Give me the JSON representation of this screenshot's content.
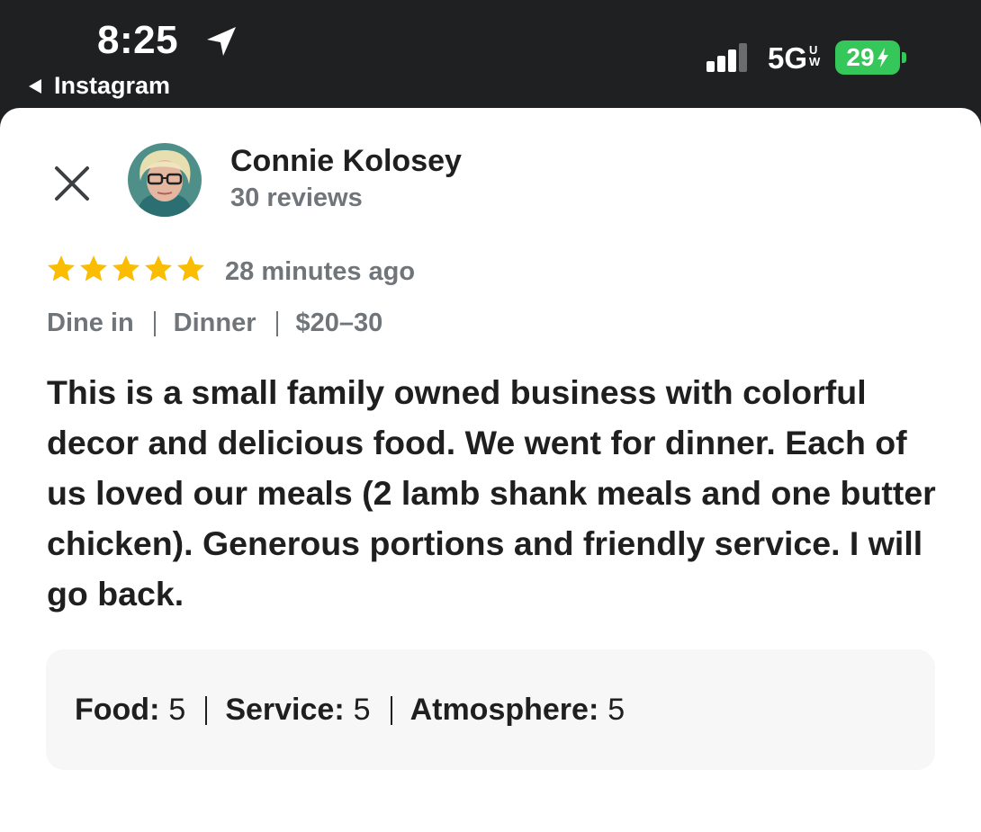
{
  "status_bar": {
    "time": "8:25",
    "back_app": "Instagram",
    "network": "5G",
    "network_sub_top": "U",
    "network_sub_bottom": "W",
    "battery": "29"
  },
  "review": {
    "author_name": "Connie Kolosey",
    "review_count": "30 reviews",
    "rating": 5,
    "time_ago": "28 minutes ago",
    "tags": [
      "Dine in",
      "Dinner",
      "$20–30"
    ],
    "text": "This is a small family owned business with colorful decor and delicious food. We went for dinner. Each of us loved our meals (2 lamb shank meals and one butter chicken). Generous portions and friendly service. I will go back.",
    "ratings": [
      {
        "label": "Food:",
        "value": "5"
      },
      {
        "label": "Service:",
        "value": "5"
      },
      {
        "label": "Atmosphere:",
        "value": "5"
      }
    ]
  },
  "colors": {
    "status_bar_bg": "#1f2022",
    "battery_green": "#35c759",
    "star_yellow": "#fbbc04",
    "text_primary": "#1f1f1f",
    "text_secondary": "#70757a",
    "ratings_box_bg": "#f7f7f7"
  },
  "icons": {
    "location": "location-arrow-icon",
    "back": "back-triangle-icon",
    "signal": "cellular-signal-icon",
    "close": "close-icon",
    "star": "star-icon"
  }
}
